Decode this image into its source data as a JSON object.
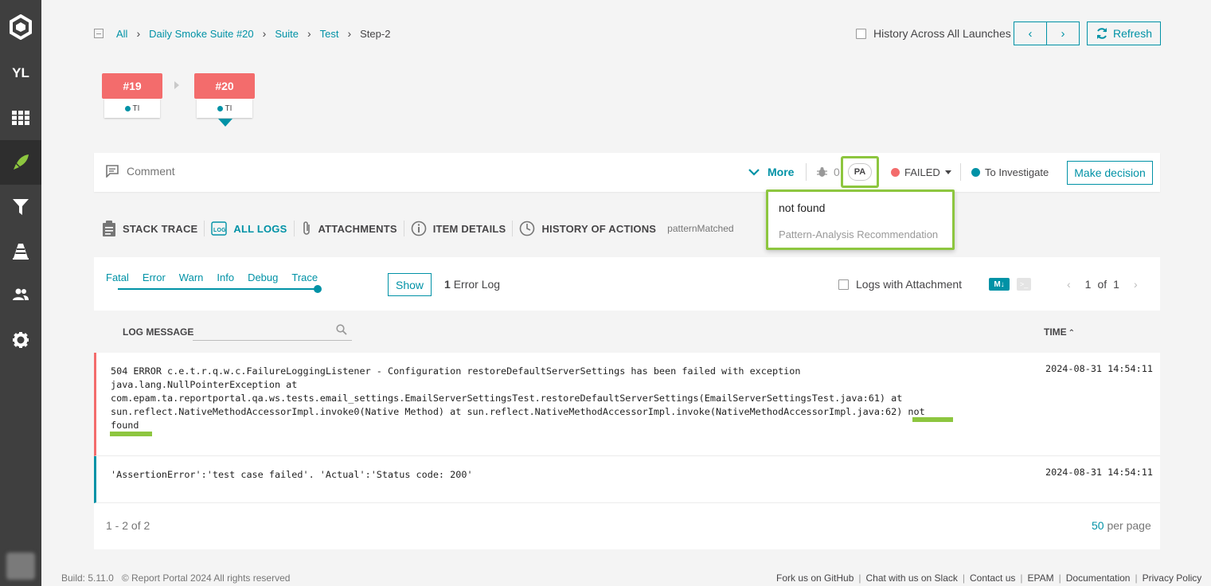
{
  "sidebar": {
    "user_initials": "YL"
  },
  "breadcrumb": [
    "All",
    "Daily Smoke Suite #20",
    "Suite",
    "Test",
    "Step-2"
  ],
  "header": {
    "history_label": "History Across All Launches",
    "refresh_label": "Refresh"
  },
  "launches": [
    {
      "num": "#19",
      "badge": "TI"
    },
    {
      "num": "#20",
      "badge": "TI"
    }
  ],
  "comment_bar": {
    "comment_label": "Comment",
    "more_label": "More",
    "defect_count": "0",
    "pa_label": "PA",
    "status": "FAILED",
    "defect_type": "To Investigate",
    "decision_label": "Make decision"
  },
  "pa_popup": {
    "title": "not found",
    "subtitle": "Pattern-Analysis Recommendation"
  },
  "tabs": [
    "STACK TRACE",
    "ALL LOGS",
    "ATTACHMENTS",
    "ITEM DETAILS",
    "HISTORY OF ACTIONS"
  ],
  "tab_extra": "patternMatched",
  "log_panel": {
    "levels": [
      "Fatal",
      "Error",
      "Warn",
      "Info",
      "Debug",
      "Trace"
    ],
    "show_label": "Show",
    "error_count": "1",
    "error_label": "Error Log",
    "with_attachment": "Logs with Attachment",
    "md_label": "M↓",
    "page_current": "1",
    "page_of": "of",
    "page_total": "1",
    "log_message_header": "LOG MESSAGE",
    "time_header": "TIME"
  },
  "logs": [
    {
      "message": "504 ERROR c.e.t.r.q.w.c.FailureLoggingListener - Configuration restoreDefaultServerSettings has been failed with exception\njava.lang.NullPointerException at\ncom.epam.ta.reportportal.qa.ws.tests.email_settings.EmailServerSettingsTest.restoreDefaultServerSettings(EmailServerSettingsTest.java:61) at\nsun.reflect.NativeMethodAccessorImpl.invoke0(Native Method) at sun.reflect.NativeMethodAccessorImpl.invoke(NativeMethodAccessorImpl.java:62) not\nfound",
      "time": "2024-08-31 14:54:11",
      "level": "error"
    },
    {
      "message": "'AssertionError':'test case failed'. 'Actual':'Status code: 200'",
      "time": "2024-08-31 14:54:11",
      "level": "info"
    }
  ],
  "footer_table": {
    "range": "1 - 2 of 2",
    "per_page_num": "50",
    "per_page_label": "per page"
  },
  "footer": {
    "build": "Build: 5.11.0   © Report Portal 2024 All rights reserved",
    "links": [
      "Fork us on GitHub",
      "Chat with us on Slack",
      "Contact us",
      "EPAM",
      "Documentation",
      "Privacy Policy"
    ]
  },
  "colors": {
    "accent": "#0092a6",
    "failed": "#f36c6c",
    "highlight": "#8dc63f",
    "sidebar": "#3f3f3f"
  }
}
